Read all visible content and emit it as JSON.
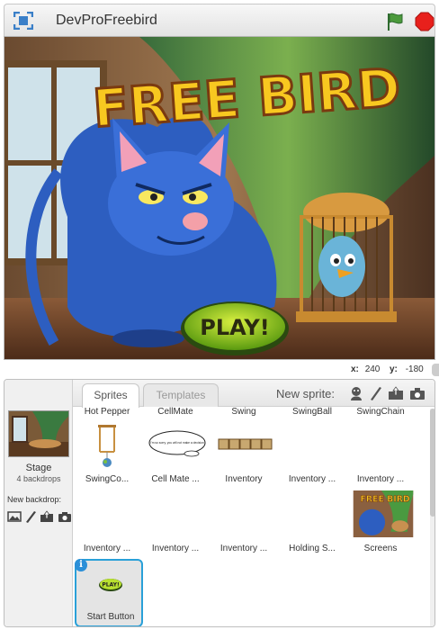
{
  "titlebar": {
    "project_title": "DevProFreebird",
    "fullscreen_icon": "fullscreen-icon",
    "flag_icon": "green-flag-icon",
    "stop_icon": "stop-icon"
  },
  "stage_view": {
    "title_text": "FREE BIRD",
    "play_label": "PLAY!"
  },
  "coords": {
    "x_label": "x:",
    "x_value": "240",
    "y_label": "y:",
    "y_value": "-180"
  },
  "stage_panel": {
    "label": "Stage",
    "backdrops": "4 backdrops",
    "new_backdrop_label": "New backdrop:"
  },
  "tabs": {
    "sprites": "Sprites",
    "templates": "Templates"
  },
  "new_sprite_label": "New sprite:",
  "top_row": [
    "Hot Pepper",
    "CellMate",
    "Swing",
    "SwingBall",
    "SwingChain"
  ],
  "sprites": [
    {
      "label": "SwingCo..."
    },
    {
      "label": "Cell Mate ...",
      "bubble_text": "I'm so sorry, you will not make a decision"
    },
    {
      "label": "Inventory"
    },
    {
      "label": "Inventory ..."
    },
    {
      "label": "Inventory ..."
    },
    {
      "label": "Inventory ..."
    },
    {
      "label": "Inventory ..."
    },
    {
      "label": "Inventory ..."
    },
    {
      "label": "Holding S..."
    },
    {
      "label": "Screens",
      "thumb_title": "FREE BIRD"
    },
    {
      "label": "Start Button",
      "thumb_text": "PLAY!",
      "info": "i"
    }
  ],
  "colors": {
    "accent": "#29a0d8",
    "flag": "#3d8a3d",
    "stop": "#e8201c"
  }
}
